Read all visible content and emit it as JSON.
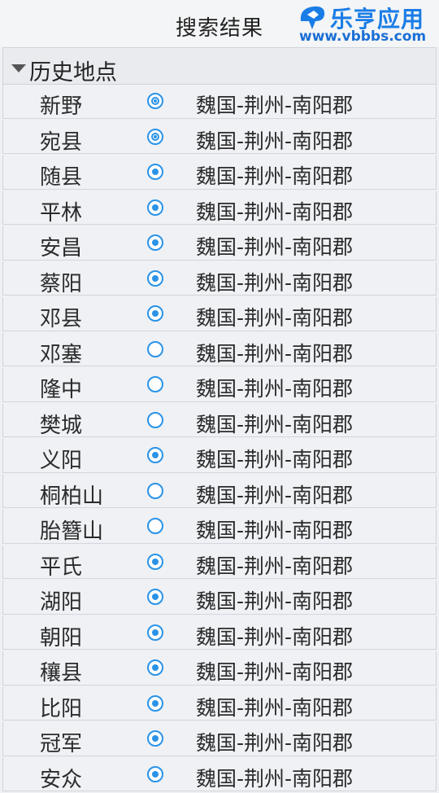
{
  "header": {
    "title": "搜索结果",
    "watermark_name": "乐亨应用",
    "watermark_url": "www.vbbbs.com"
  },
  "section": {
    "title": "历史地点",
    "expanded": true
  },
  "accent_color": "#2a93e8",
  "rows": [
    {
      "name": "新野",
      "status": "ring",
      "region": "魏国-荆州-南阳郡"
    },
    {
      "name": "宛县",
      "status": "ring",
      "region": "魏国-荆州-南阳郡"
    },
    {
      "name": "随县",
      "status": "dot",
      "region": "魏国-荆州-南阳郡"
    },
    {
      "name": "平林",
      "status": "dot",
      "region": "魏国-荆州-南阳郡"
    },
    {
      "name": "安昌",
      "status": "dot",
      "region": "魏国-荆州-南阳郡"
    },
    {
      "name": "蔡阳",
      "status": "dot",
      "region": "魏国-荆州-南阳郡"
    },
    {
      "name": "邓县",
      "status": "dot",
      "region": "魏国-荆州-南阳郡"
    },
    {
      "name": "邓塞",
      "status": "empty",
      "region": "魏国-荆州-南阳郡"
    },
    {
      "name": "隆中",
      "status": "empty",
      "region": "魏国-荆州-南阳郡"
    },
    {
      "name": "樊城",
      "status": "empty",
      "region": "魏国-荆州-南阳郡"
    },
    {
      "name": "义阳",
      "status": "dot",
      "region": "魏国-荆州-南阳郡"
    },
    {
      "name": "桐柏山",
      "status": "empty",
      "region": "魏国-荆州-南阳郡"
    },
    {
      "name": "胎簪山",
      "status": "empty",
      "region": "魏国-荆州-南阳郡"
    },
    {
      "name": "平氏",
      "status": "dot",
      "region": "魏国-荆州-南阳郡"
    },
    {
      "name": "湖阳",
      "status": "dot",
      "region": "魏国-荆州-南阳郡"
    },
    {
      "name": "朝阳",
      "status": "dot",
      "region": "魏国-荆州-南阳郡"
    },
    {
      "name": "穰县",
      "status": "dot",
      "region": "魏国-荆州-南阳郡"
    },
    {
      "name": "比阳",
      "status": "dot",
      "region": "魏国-荆州-南阳郡"
    },
    {
      "name": "冠军",
      "status": "dot",
      "region": "魏国-荆州-南阳郡"
    },
    {
      "name": "安众",
      "status": "dot",
      "region": "魏国-荆州-南阳郡"
    }
  ]
}
